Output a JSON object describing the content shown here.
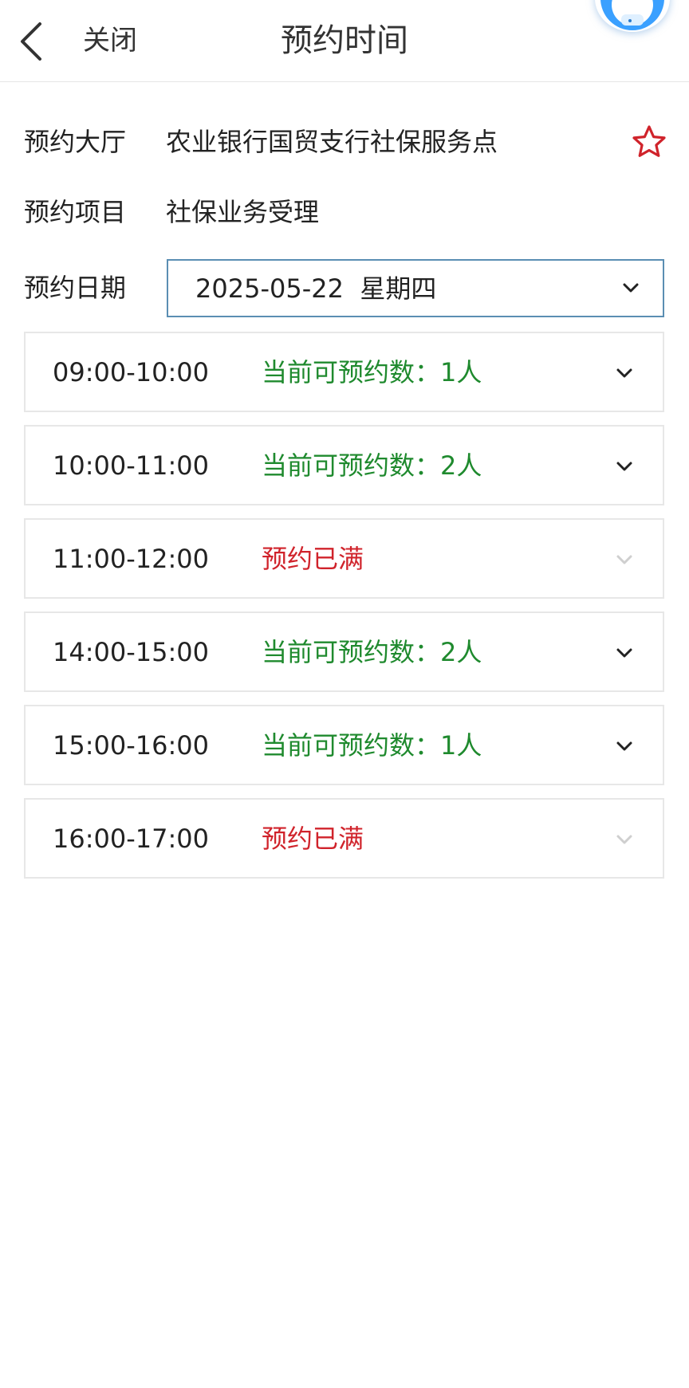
{
  "header": {
    "close_label": "关闭",
    "title": "预约时间"
  },
  "info": {
    "hall_label": "预约大厅",
    "hall_value": "农业银行国贸支行社保服务点",
    "item_label": "预约项目",
    "item_value": "社保业务受理",
    "date_label": "预约日期",
    "date_value": "2025-05-22  星期四"
  },
  "slots": [
    {
      "time": "09:00-10:00",
      "status": "当前可预约数：1人",
      "available": true
    },
    {
      "time": "10:00-11:00",
      "status": "当前可预约数：2人",
      "available": true
    },
    {
      "time": "11:00-12:00",
      "status": "预约已满",
      "available": false
    },
    {
      "time": "14:00-15:00",
      "status": "当前可预约数：2人",
      "available": true
    },
    {
      "time": "15:00-16:00",
      "status": "当前可预约数：1人",
      "available": true
    },
    {
      "time": "16:00-17:00",
      "status": "预约已满",
      "available": false
    }
  ],
  "colors": {
    "available": "#1f8a2e",
    "full": "#d0232b",
    "star": "#d0232b",
    "select_border": "#5a8eb3",
    "assistant_accent": "#3aa0ff"
  },
  "icons": [
    "back-arrow-icon",
    "star-outline-icon",
    "chevron-down-icon",
    "assistant-avatar-icon"
  ]
}
